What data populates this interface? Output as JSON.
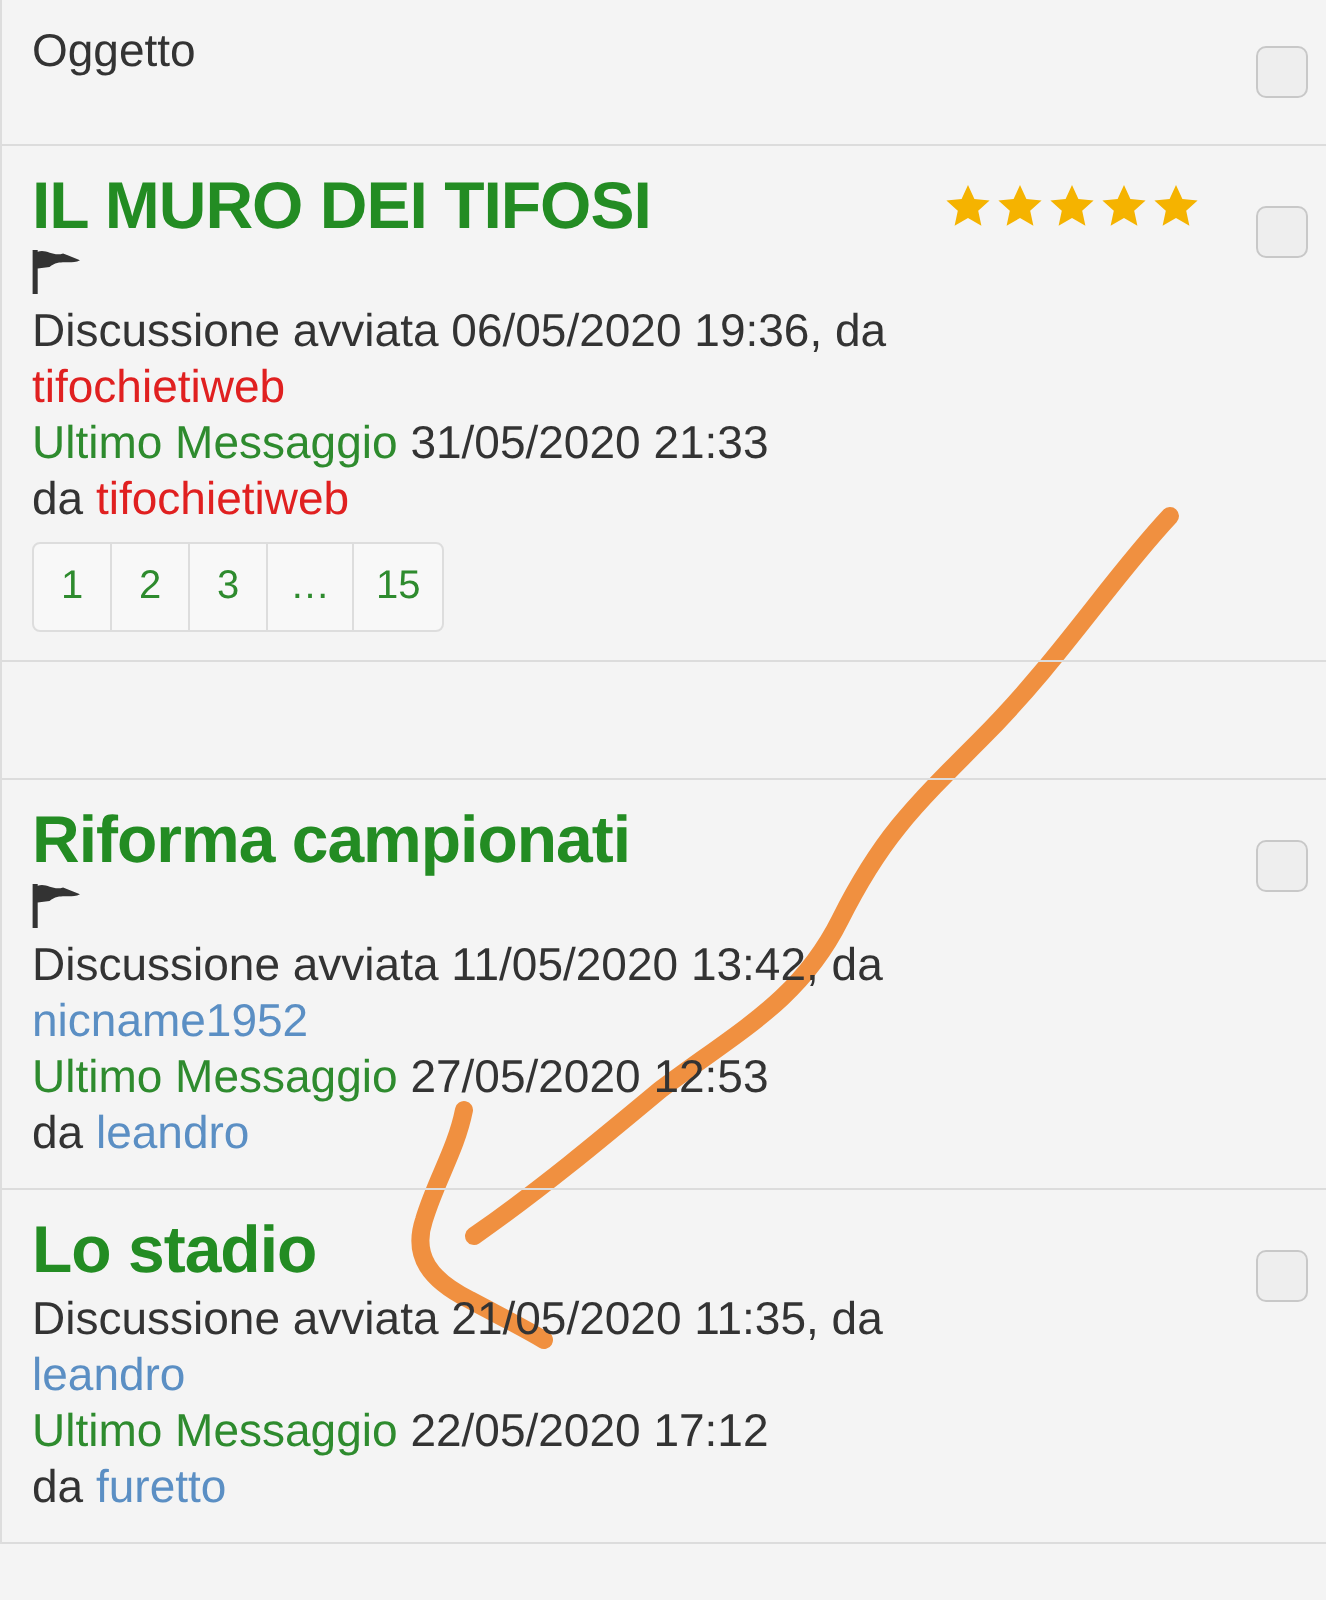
{
  "header": {
    "label": "Oggetto",
    "checked": false
  },
  "threads": [
    {
      "title": "IL MURO DEI TIFOSI",
      "flagged": true,
      "stars": 5,
      "started": "Discussione avviata 06/05/2020 19:36, da",
      "starter": {
        "name": "tifochietiweb",
        "color": "#e02020"
      },
      "last_label": "Ultimo Messaggio",
      "last_date": "31/05/2020 21:33",
      "by_label": "da",
      "last_author": {
        "name": "tifochietiweb",
        "color": "#e02020"
      },
      "pages": [
        "1",
        "2",
        "3",
        "…",
        "15"
      ],
      "checked": false,
      "gap_after": true
    },
    {
      "title": "Riforma campionati",
      "flagged": true,
      "started": "Discussione avviata 11/05/2020 13:42, da",
      "starter": {
        "name": "nicname1952",
        "color": "#5b8fc4"
      },
      "last_label": "Ultimo Messaggio",
      "last_date": "27/05/2020 12:53",
      "by_label": "da",
      "last_author": {
        "name": "leandro",
        "color": "#5b8fc4"
      },
      "checked": false
    },
    {
      "title": "Lo stadio",
      "flagged": false,
      "started": "Discussione avviata 21/05/2020 11:35, da",
      "starter": {
        "name": "leandro",
        "color": "#5b8fc4"
      },
      "last_label": "Ultimo Messaggio",
      "last_date": "22/05/2020 17:12",
      "by_label": "da",
      "last_author": {
        "name": "furetto",
        "color": "#5b8fc4"
      },
      "checked": false
    }
  ],
  "annotations": [
    {
      "kind": "arrow"
    }
  ]
}
